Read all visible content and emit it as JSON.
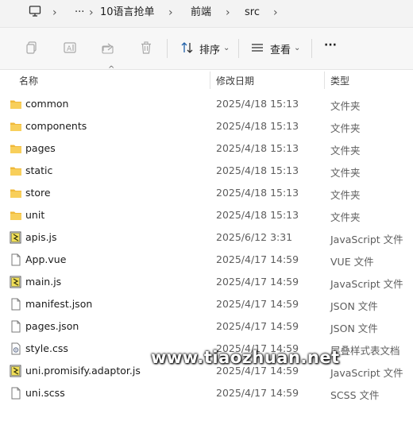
{
  "breadcrumb": {
    "more": "···",
    "items": [
      "10语言抢单",
      "前端",
      "src"
    ]
  },
  "toolbar": {
    "sort_label": "排序",
    "view_label": "查看",
    "more_label": "···"
  },
  "columns": {
    "name": "名称",
    "date": "修改日期",
    "type": "类型"
  },
  "rows": [
    {
      "name": "common",
      "date": "2025/4/18 15:13",
      "type": "文件夹",
      "kind": "folder"
    },
    {
      "name": "components",
      "date": "2025/4/18 15:13",
      "type": "文件夹",
      "kind": "folder"
    },
    {
      "name": "pages",
      "date": "2025/4/18 15:13",
      "type": "文件夹",
      "kind": "folder"
    },
    {
      "name": "static",
      "date": "2025/4/18 15:13",
      "type": "文件夹",
      "kind": "folder"
    },
    {
      "name": "store",
      "date": "2025/4/18 15:13",
      "type": "文件夹",
      "kind": "folder"
    },
    {
      "name": "unit",
      "date": "2025/4/18 15:13",
      "type": "文件夹",
      "kind": "folder"
    },
    {
      "name": "apis.js",
      "date": "2025/6/12 3:31",
      "type": "JavaScript 文件",
      "kind": "js"
    },
    {
      "name": "App.vue",
      "date": "2025/4/17 14:59",
      "type": "VUE 文件",
      "kind": "file"
    },
    {
      "name": "main.js",
      "date": "2025/4/17 14:59",
      "type": "JavaScript 文件",
      "kind": "js"
    },
    {
      "name": "manifest.json",
      "date": "2025/4/17 14:59",
      "type": "JSON 文件",
      "kind": "file"
    },
    {
      "name": "pages.json",
      "date": "2025/4/17 14:59",
      "type": "JSON 文件",
      "kind": "file"
    },
    {
      "name": "style.css",
      "date": "2025/4/17 14:59",
      "type": "层叠样式表文档",
      "kind": "css"
    },
    {
      "name": "uni.promisify.adaptor.js",
      "date": "2025/4/17 14:59",
      "type": "JavaScript 文件",
      "kind": "js"
    },
    {
      "name": "uni.scss",
      "date": "2025/4/17 14:59",
      "type": "SCSS 文件",
      "kind": "file"
    }
  ],
  "watermark": "www.tiaozhuan.net"
}
